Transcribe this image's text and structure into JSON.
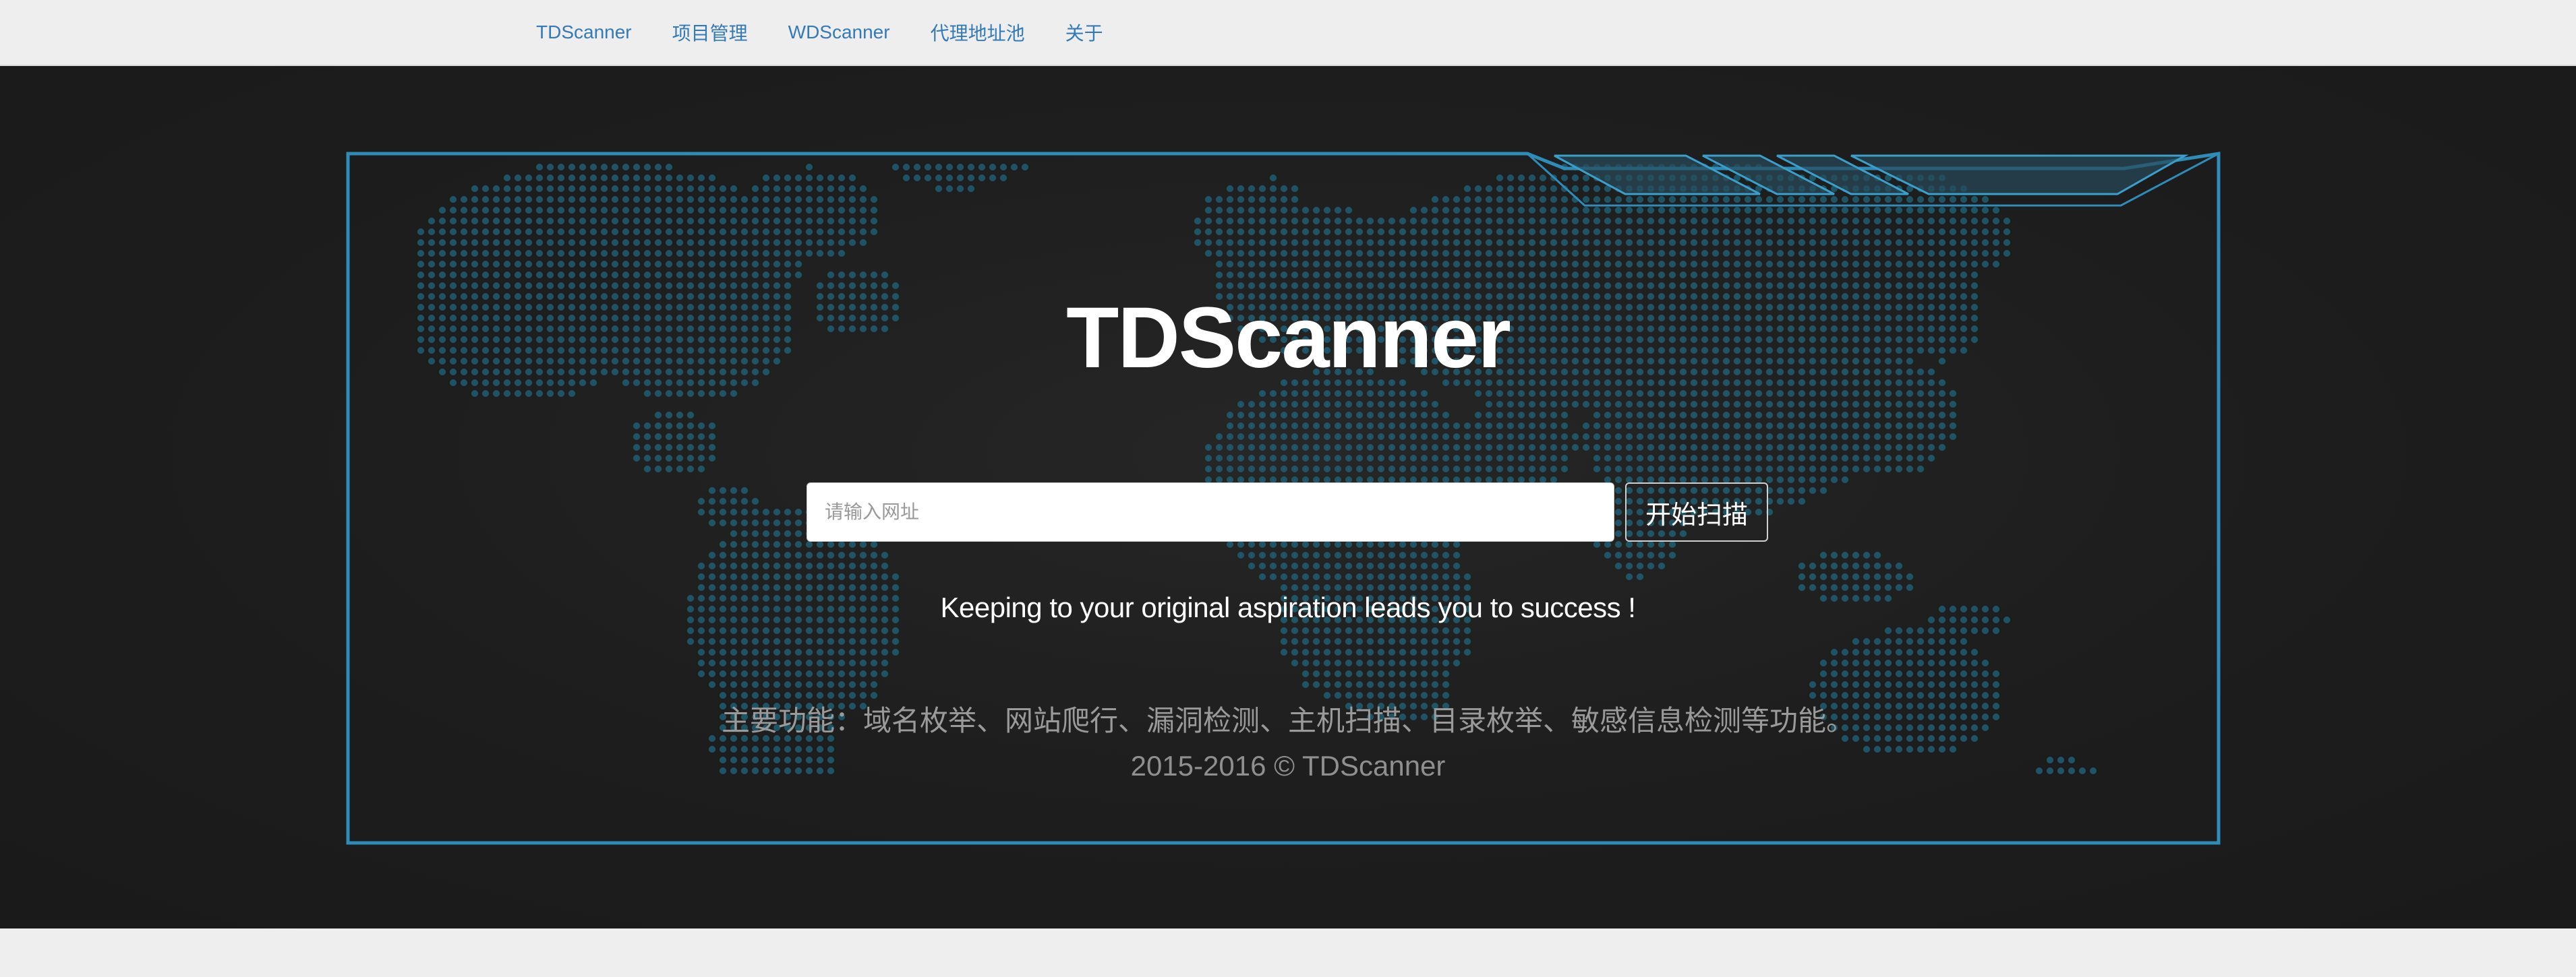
{
  "nav": {
    "items": [
      {
        "label": "TDScanner"
      },
      {
        "label": "项目管理"
      },
      {
        "label": "WDScanner"
      },
      {
        "label": "代理地址池"
      },
      {
        "label": "关于"
      }
    ]
  },
  "hero": {
    "title": "TDScanner",
    "search": {
      "placeholder": "请输入网址",
      "value": ""
    },
    "scan_button_label": "开始扫描",
    "slogan": "Keeping to your original aspiration leads you to success !",
    "features": "主要功能：域名枚举、网站爬行、漏洞检测、主机扫描、目录枚举、敏感信息检测等功能。",
    "copyright": "2015-2016 © TDScanner"
  },
  "colors": {
    "link": "#337ab7",
    "frame": "#2e8cb8",
    "map_dots": "#1e5f73",
    "background": "#1d1d1d"
  },
  "decor": {
    "background_image": "world-map-dots",
    "frame": "tech-frame"
  }
}
